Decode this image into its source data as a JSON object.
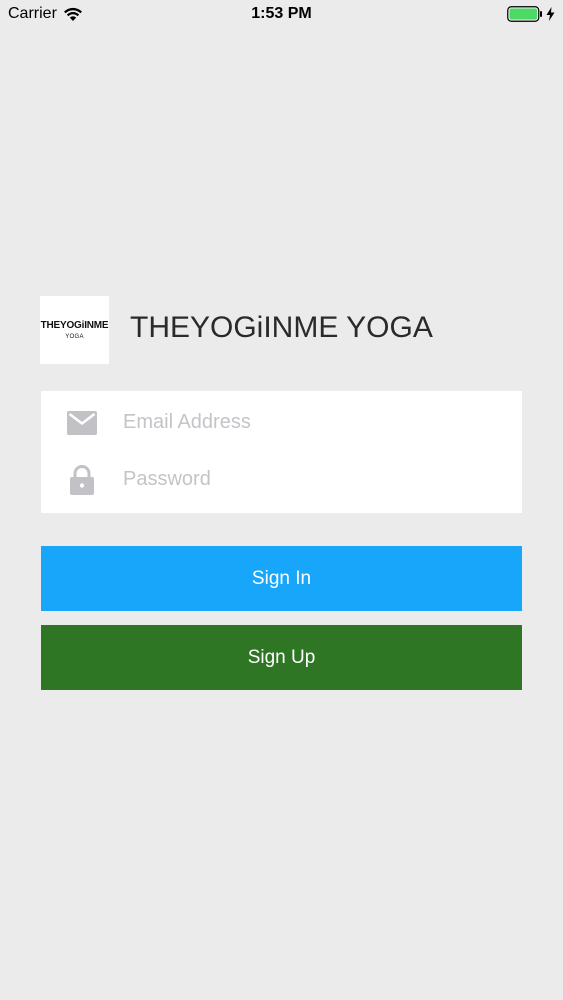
{
  "status_bar": {
    "carrier": "Carrier",
    "time": "1:53 PM",
    "battery_color": "#4cd964",
    "battery_level": 1.0
  },
  "logo": {
    "main": "THEYOGiINME",
    "sub": "YOGA"
  },
  "app": {
    "title": "THEYOGiINME YOGA"
  },
  "form": {
    "email": {
      "placeholder": "Email Address",
      "value": "",
      "icon": "envelope-icon"
    },
    "password": {
      "placeholder": "Password",
      "value": "",
      "icon": "lock-icon"
    }
  },
  "buttons": {
    "sign_in": "Sign In",
    "sign_up": "Sign Up"
  },
  "colors": {
    "background": "#ebebeb",
    "sign_in": "#17a6f9",
    "sign_up": "#2e7524",
    "icon_gray": "#c2c2c6"
  }
}
